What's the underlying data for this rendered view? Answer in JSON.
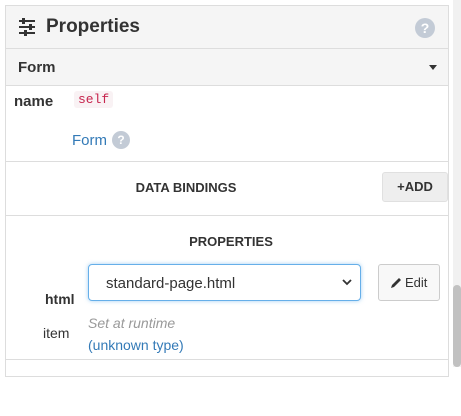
{
  "panel": {
    "title": "Properties",
    "icon": "sliders-icon",
    "help_icon": "question-circle-icon"
  },
  "component_type": {
    "label": "Form",
    "icon": "caret-down-icon"
  },
  "name_field": {
    "label": "name",
    "value": "self",
    "type_link": "Form"
  },
  "data_bindings": {
    "heading": "DATA BINDINGS",
    "add_label": "ADD"
  },
  "properties": {
    "heading": "PROPERTIES",
    "html": {
      "label": "html",
      "value": "standard-page.html",
      "edit_label": "Edit"
    },
    "item": {
      "label": "item",
      "hint": "Set at runtime",
      "type": "(unknown type)"
    }
  },
  "colors": {
    "link": "#337ab7",
    "code_text": "#c7254e",
    "code_bg": "#f9f2f4",
    "header_bg": "#f5f5f5",
    "focus_border": "#66afe9"
  }
}
